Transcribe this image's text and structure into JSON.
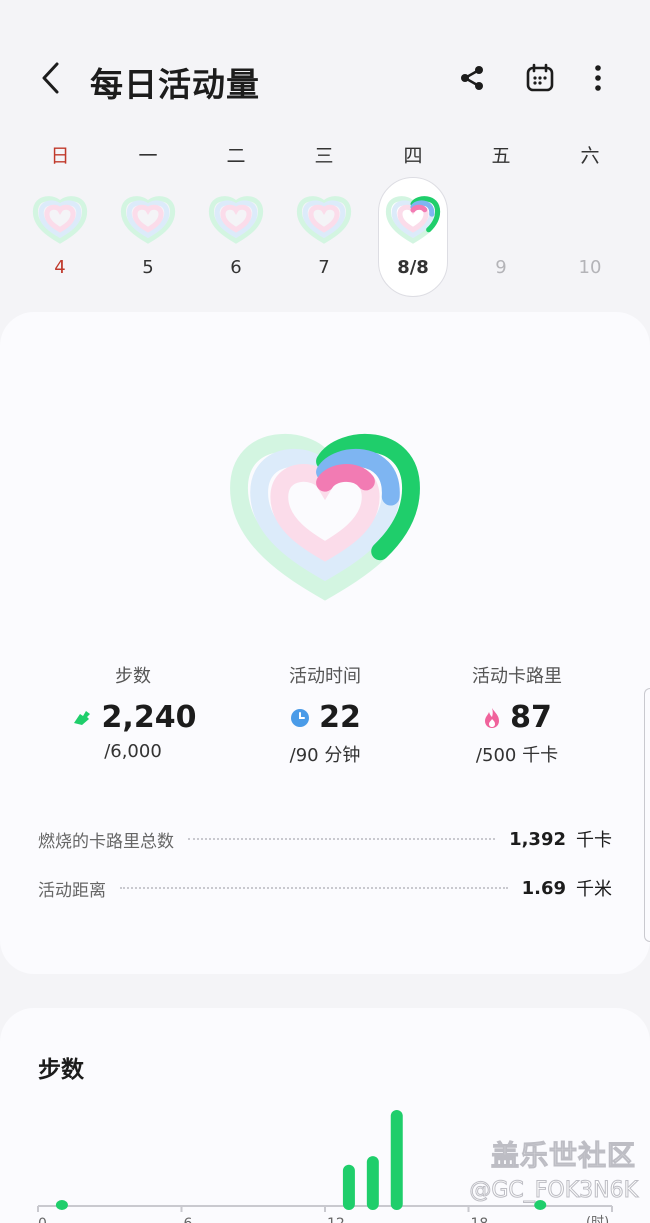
{
  "header": {
    "title": "每日活动量",
    "icons": [
      "back-arrow-icon",
      "share-icon",
      "calendar-icon",
      "more-vertical-icon"
    ]
  },
  "week": {
    "days": [
      {
        "name": "日",
        "num": "4",
        "has_ring": true,
        "is_sunday": true
      },
      {
        "name": "一",
        "num": "5",
        "has_ring": true
      },
      {
        "name": "二",
        "num": "6",
        "has_ring": true
      },
      {
        "name": "三",
        "num": "7",
        "has_ring": true
      },
      {
        "name": "四",
        "num": "8/8",
        "has_ring": true,
        "selected": true,
        "progress": {
          "steps": 0.37,
          "time": 0.24,
          "cal": 0.17
        }
      },
      {
        "name": "五",
        "num": "9",
        "has_ring": false,
        "future": true
      },
      {
        "name": "六",
        "num": "10",
        "has_ring": false,
        "future": true
      }
    ]
  },
  "summary": {
    "progress": {
      "steps": 0.37,
      "active_time": 0.24,
      "active_calories": 0.17
    },
    "colors": {
      "steps": "#1fce6b",
      "active_time": "#7eb5f2",
      "active_calories": "#f27bb3"
    },
    "stats": [
      {
        "label": "步数",
        "value": "2,240",
        "goal": "/6,000",
        "icon": "running-shoe-icon",
        "color": "#1fce6b"
      },
      {
        "label": "活动时间",
        "value": "22",
        "goal": "/90 分钟",
        "icon": "clock-icon",
        "color": "#4a9be8"
      },
      {
        "label": "活动卡路里",
        "value": "87",
        "goal": "/500 千卡",
        "icon": "flame-icon",
        "color": "#f0639c"
      }
    ],
    "details": [
      {
        "label": "燃烧的卡路里总数",
        "value": "1,392",
        "unit": "千卡"
      },
      {
        "label": "活动距离",
        "value": "1.69",
        "unit": "千米"
      }
    ]
  },
  "steps_card": {
    "title": "步数"
  },
  "chart_data": {
    "type": "bar",
    "title": "步数",
    "x_unit": "(时)",
    "xlim": [
      0,
      24
    ],
    "x_tick_labels": [
      "0",
      "6",
      "12",
      "18"
    ],
    "bars": [
      {
        "hour": 1,
        "value": 0.04
      },
      {
        "hour": 13,
        "value": 0.43
      },
      {
        "hour": 14,
        "value": 0.52
      },
      {
        "hour": 15,
        "value": 1.0
      },
      {
        "hour": 21,
        "value": 0.04
      }
    ],
    "color": "#1fce6b"
  },
  "watermark": {
    "line1": "盖乐世社区",
    "line2": "@GC_FOK3N6K"
  }
}
